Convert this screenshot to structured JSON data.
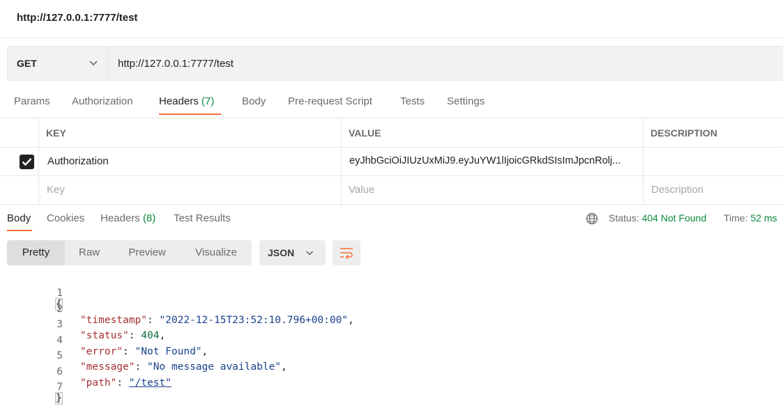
{
  "window": {
    "title": "http://127.0.0.1:7777/test"
  },
  "request": {
    "method": "GET",
    "url": "http://127.0.0.1:7777/test",
    "tabs": {
      "params": "Params",
      "authorization": "Authorization",
      "headers": "Headers",
      "headers_count": "(7)",
      "body": "Body",
      "prerequest": "Pre-request Script",
      "tests": "Tests",
      "settings": "Settings"
    }
  },
  "headers_table": {
    "columns": {
      "key": "KEY",
      "value": "VALUE",
      "description": "DESCRIPTION"
    },
    "rows": [
      {
        "checked": true,
        "key": "Authorization",
        "value": "eyJhbGciOiJIUzUxMiJ9.eyJuYW1lIjoicGRkdSIsImJpcnRolj...",
        "description": ""
      }
    ],
    "placeholders": {
      "key": "Key",
      "value": "Value",
      "description": "Description"
    }
  },
  "response": {
    "tabs": {
      "body": "Body",
      "cookies": "Cookies",
      "headers": "Headers",
      "headers_count": "(8)",
      "test_results": "Test Results"
    },
    "status_label": "Status:",
    "status_value": "404 Not Found",
    "time_label": "Time:",
    "time_value": "52 ms",
    "view_modes": {
      "pretty": "Pretty",
      "raw": "Raw",
      "preview": "Preview",
      "visualize": "Visualize"
    },
    "format": "JSON",
    "code": {
      "line_numbers": [
        "1",
        "2",
        "3",
        "4",
        "5",
        "6",
        "7"
      ],
      "open_brace": "{",
      "close_brace": "}",
      "fields": [
        {
          "key": "\"timestamp\"",
          "value": "\"2022-12-15T23:52:10.796+00:00\"",
          "sep": ","
        },
        {
          "key": "\"status\"",
          "value": "404",
          "sep": ","
        },
        {
          "key": "\"error\"",
          "value": "\"Not Found\"",
          "sep": ","
        },
        {
          "key": "\"message\"",
          "value": "\"No message available\"",
          "sep": ","
        },
        {
          "key": "\"path\"",
          "value": "\"/test\"",
          "sep": ""
        }
      ]
    }
  },
  "colors": {
    "accent": "#ff6c37",
    "success": "#0a8a3c"
  }
}
